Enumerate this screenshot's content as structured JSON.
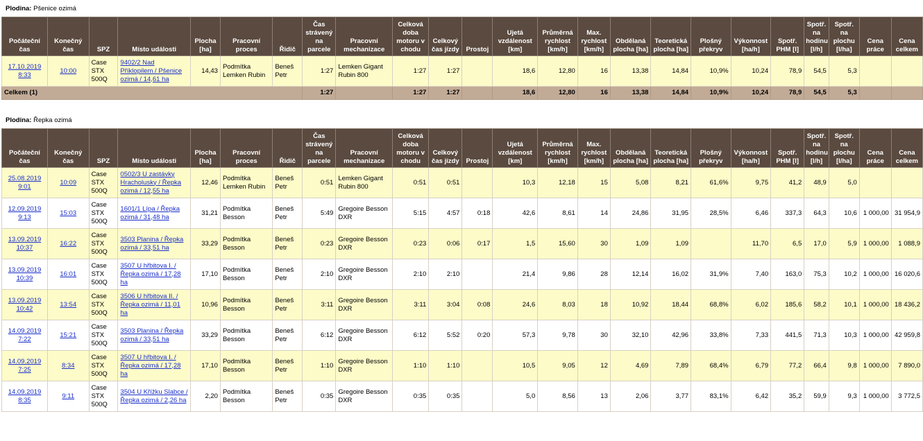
{
  "headers": [
    "Počáteční čas",
    "Konečný čas",
    "SPZ",
    "Místo události",
    "Plocha [ha]",
    "Pracovní proces",
    "Řidič",
    "Čas strávený na parcele",
    "Pracovní mechanizace",
    "Celková doba motoru v chodu",
    "Celkový čas jízdy",
    "Prostoj",
    "Ujetá vzdálenost [km]",
    "Průměrná rychlost [km/h]",
    "Max. rychlost [km/h]",
    "Obdělaná plocha [ha]",
    "Teoretická plocha [ha]",
    "Plošný překryv",
    "Výkonnost [ha/h]",
    "Spotř. PHM [l]",
    "Spotř. na hodinu [l/h]",
    "Spotř. na plochu [l/ha]",
    "Cena práce",
    "Cena celkem"
  ],
  "sections": [
    {
      "label": "Plodina:",
      "crop": "Pšenice ozimá",
      "rows": [
        {
          "start_date": "17.10.2019",
          "start_time": "8:33",
          "end": "10:00",
          "spz": [
            "Case",
            "STX",
            "500Q"
          ],
          "place": "9402/2 Nad Příklopilem / Pšenice ozimá / 14,61 ha",
          "area": "14,43",
          "process": "Podmítka Lemken Rubin",
          "driver": "Beneš Petr",
          "time_parcel": "1:27",
          "machine": "Lemken Gigant Rubin 800",
          "engine": "1:27",
          "drive": "1:27",
          "idle": "",
          "dist": "18,6",
          "avg": "12,80",
          "max": "16",
          "worked": "13,38",
          "theor": "14,84",
          "overlap": "10,9%",
          "perf": "10,24",
          "fuel": "78,9",
          "fuel_h": "54,5",
          "fuel_ha": "5,3",
          "price": "",
          "total": ""
        }
      ],
      "total": {
        "label": "Celkem (1)",
        "time_parcel": "1:27",
        "engine": "1:27",
        "drive": "1:27",
        "idle": "",
        "dist": "18,6",
        "avg": "12,80",
        "max": "16",
        "worked": "13,38",
        "theor": "14,84",
        "overlap": "10,9%",
        "perf": "10,24",
        "fuel": "78,9",
        "fuel_h": "54,5",
        "fuel_ha": "5,3",
        "price": "",
        "total": ""
      }
    },
    {
      "label": "Plodina:",
      "crop": "Řepka ozimá",
      "rows": [
        {
          "start_date": "25.08.2019",
          "start_time": "9:01",
          "end": "10:09",
          "spz": [
            "Case",
            "STX",
            "500Q"
          ],
          "place": "0502/3 U zastávky Hracholusky / Řepka ozimá / 12,55 ha",
          "area": "12,46",
          "process": "Podmítka Lemken Rubin",
          "driver": "Beneš Petr",
          "time_parcel": "0:51",
          "machine": "Lemken Gigant Rubin 800",
          "engine": "0:51",
          "drive": "0:51",
          "idle": "",
          "dist": "10,3",
          "avg": "12,18",
          "max": "15",
          "worked": "5,08",
          "theor": "8,21",
          "overlap": "61,6%",
          "perf": "9,75",
          "fuel": "41,2",
          "fuel_h": "48,9",
          "fuel_ha": "5,0",
          "price": "",
          "total": ""
        },
        {
          "start_date": "12.09.2019",
          "start_time": "9:13",
          "end": "15:03",
          "spz": [
            "Case",
            "STX",
            "500Q"
          ],
          "place": "1601/1 Lípa / Řepka ozimá / 31,48 ha",
          "area": "31,21",
          "process": "Podmítka Besson",
          "driver": "Beneš Petr",
          "time_parcel": "5:49",
          "machine": "Gregoire Besson DXR",
          "engine": "5:15",
          "drive": "4:57",
          "idle": "0:18",
          "dist": "42,6",
          "avg": "8,61",
          "max": "14",
          "worked": "24,86",
          "theor": "31,95",
          "overlap": "28,5%",
          "perf": "6,46",
          "fuel": "337,3",
          "fuel_h": "64,3",
          "fuel_ha": "10,6",
          "price": "1 000,00",
          "total": "31 954,9"
        },
        {
          "start_date": "13.09.2019",
          "start_time": "10:37",
          "end": "16:22",
          "spz": [
            "Case",
            "STX",
            "500Q"
          ],
          "place": "3503 Planina / Řepka ozimá / 33,51 ha",
          "area": "33,29",
          "process": "Podmítka Besson",
          "driver": "Beneš Petr",
          "time_parcel": "0:23",
          "machine": "Gregoire Besson DXR",
          "engine": "0:23",
          "drive": "0:06",
          "idle": "0:17",
          "dist": "1,5",
          "avg": "15,60",
          "max": "30",
          "worked": "1,09",
          "theor": "1,09",
          "overlap": "",
          "perf": "11,70",
          "fuel": "6,5",
          "fuel_h": "17,0",
          "fuel_ha": "5,9",
          "price": "1 000,00",
          "total": "1 088,9"
        },
        {
          "start_date": "13.09.2019",
          "start_time": "10:39",
          "end": "16:01",
          "spz": [
            "Case",
            "STX",
            "500Q"
          ],
          "place": "3507 U hřbitova I. / Řepka ozimá / 17,28 ha",
          "area": "17,10",
          "process": "Podmítka Besson",
          "driver": "Beneš Petr",
          "time_parcel": "2:10",
          "machine": "Gregoire Besson DXR",
          "engine": "2:10",
          "drive": "2:10",
          "idle": "",
          "dist": "21,4",
          "avg": "9,86",
          "max": "28",
          "worked": "12,14",
          "theor": "16,02",
          "overlap": "31,9%",
          "perf": "7,40",
          "fuel": "163,0",
          "fuel_h": "75,3",
          "fuel_ha": "10,2",
          "price": "1 000,00",
          "total": "16 020,6"
        },
        {
          "start_date": "13.09.2019",
          "start_time": "10:42",
          "end": "13:54",
          "spz": [
            "Case",
            "STX",
            "500Q"
          ],
          "place": "3506 U hřbitova II. / Řepka ozimá / 11,01 ha",
          "area": "10,96",
          "process": "Podmítka Besson",
          "driver": "Beneš Petr",
          "time_parcel": "3:11",
          "machine": "Gregoire Besson DXR",
          "engine": "3:11",
          "drive": "3:04",
          "idle": "0:08",
          "dist": "24,6",
          "avg": "8,03",
          "max": "18",
          "worked": "10,92",
          "theor": "18,44",
          "overlap": "68,8%",
          "perf": "6,02",
          "fuel": "185,6",
          "fuel_h": "58,2",
          "fuel_ha": "10,1",
          "price": "1 000,00",
          "total": "18 436,2"
        },
        {
          "start_date": "14.09.2019",
          "start_time": "7:22",
          "end": "15:21",
          "spz": [
            "Case",
            "STX",
            "500Q"
          ],
          "place": "3503 Planina / Řepka ozimá / 33,51 ha",
          "area": "33,29",
          "process": "Podmítka Besson",
          "driver": "Beneš Petr",
          "time_parcel": "6:12",
          "machine": "Gregoire Besson DXR",
          "engine": "6:12",
          "drive": "5:52",
          "idle": "0:20",
          "dist": "57,3",
          "avg": "9,78",
          "max": "30",
          "worked": "32,10",
          "theor": "42,96",
          "overlap": "33,8%",
          "perf": "7,33",
          "fuel": "441,5",
          "fuel_h": "71,3",
          "fuel_ha": "10,3",
          "price": "1 000,00",
          "total": "42 959,8"
        },
        {
          "start_date": "14.09.2019",
          "start_time": "7:25",
          "end": "8:34",
          "spz": [
            "Case",
            "STX",
            "500Q"
          ],
          "place": "3507 U hřbitova I. / Řepka ozimá / 17,28 ha",
          "area": "17,10",
          "process": "Podmítka Besson",
          "driver": "Beneš Petr",
          "time_parcel": "1:10",
          "machine": "Gregoire Besson DXR",
          "engine": "1:10",
          "drive": "1:10",
          "idle": "",
          "dist": "10,5",
          "avg": "9,05",
          "max": "12",
          "worked": "4,69",
          "theor": "7,89",
          "overlap": "68,4%",
          "perf": "6,79",
          "fuel": "77,2",
          "fuel_h": "66,4",
          "fuel_ha": "9,8",
          "price": "1 000,00",
          "total": "7 890,0"
        },
        {
          "start_date": "14.09.2019",
          "start_time": "8:35",
          "end": "9:11",
          "spz": [
            "Case",
            "STX",
            "500Q"
          ],
          "place": "3504 U Křížku Slabce / Řepka ozimá / 2,26 ha",
          "area": "2,20",
          "process": "Podmítka Besson",
          "driver": "Beneš Petr",
          "time_parcel": "0:35",
          "machine": "Gregoire Besson DXR",
          "engine": "0:35",
          "drive": "0:35",
          "idle": "",
          "dist": "5,0",
          "avg": "8,56",
          "max": "13",
          "worked": "2,06",
          "theor": "3,77",
          "overlap": "83,1%",
          "perf": "6,42",
          "fuel": "35,2",
          "fuel_h": "59,9",
          "fuel_ha": "9,3",
          "price": "1 000,00",
          "total": "3 772,5"
        }
      ]
    }
  ]
}
